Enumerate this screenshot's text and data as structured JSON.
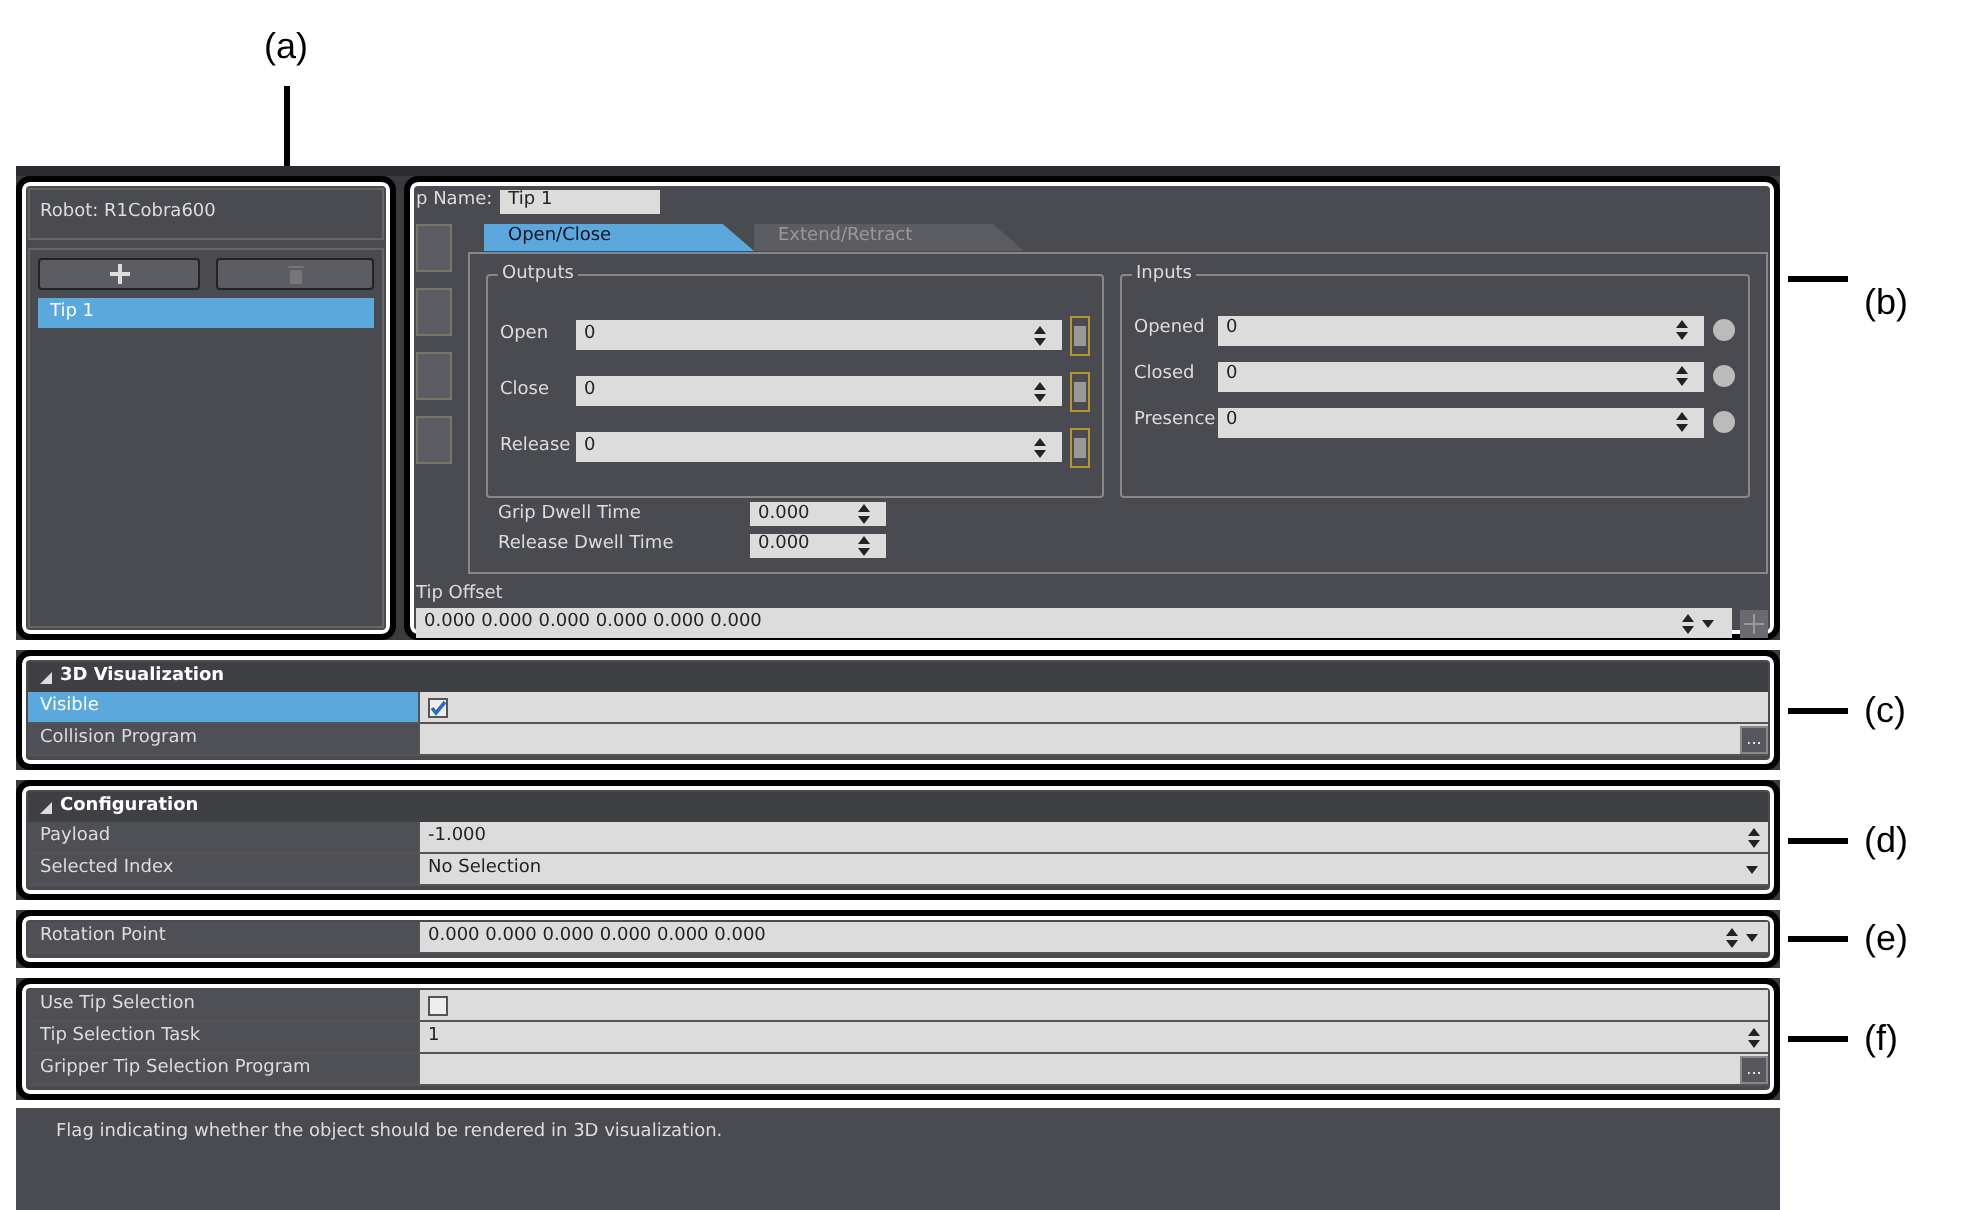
{
  "tip_list_panel": {
    "callout": "(a)",
    "robot": "Robot:  R1Cobra600",
    "items": [
      {
        "label": "Tip 1",
        "selected": true
      }
    ]
  },
  "tip_editor": {
    "callout": "(b)",
    "name_label": "p Name:",
    "name_value": "Tip 1",
    "tabs": [
      {
        "label": "Open/Close",
        "selected": true
      },
      {
        "label": "Extend/Retract",
        "selected": false
      }
    ],
    "outputs": {
      "title": "Outputs",
      "rows": [
        {
          "label": "Open",
          "value": "0"
        },
        {
          "label": "Close",
          "value": "0"
        },
        {
          "label": "Release",
          "value": "0"
        }
      ]
    },
    "inputs": {
      "title": "Inputs",
      "rows": [
        {
          "label": "Opened",
          "value": "0"
        },
        {
          "label": "Closed",
          "value": "0"
        },
        {
          "label": "Presence",
          "value": "0"
        }
      ]
    },
    "dwell": [
      {
        "label": "Grip Dwell Time",
        "value": "0.000"
      },
      {
        "label": "Release Dwell Time",
        "value": "0.000"
      }
    ],
    "tip_offset": {
      "title": "Tip Offset",
      "value": "0.000 0.000 0.000 0.000 0.000 0.000"
    }
  },
  "property_groups": [
    {
      "callout": "(c)",
      "title": "3D Visualization",
      "rows": [
        {
          "kind": "check",
          "label": "Visible",
          "checked": true,
          "selected": true
        },
        {
          "kind": "browse",
          "label": "Collision Program",
          "button": "...",
          "selected": false
        }
      ]
    },
    {
      "callout": "(d)",
      "title": "Configuration",
      "rows": [
        {
          "kind": "spin",
          "label": "Payload",
          "value": "-1.000",
          "selected": false
        },
        {
          "kind": "dropdown",
          "label": "Selected Index",
          "value": "No Selection",
          "selected": false
        }
      ]
    },
    {
      "callout": "(e)",
      "rows": [
        {
          "kind": "spindrop",
          "label": "Rotation Point",
          "value": "0.000 0.000 0.000 0.000 0.000 0.000",
          "selected": false
        }
      ]
    },
    {
      "callout": "(f)",
      "rows": [
        {
          "kind": "check",
          "label": "Use Tip Selection",
          "checked": false,
          "selected": false
        },
        {
          "kind": "spin",
          "label": "Tip Selection Task",
          "value": "1",
          "selected": false
        },
        {
          "kind": "browse",
          "label": "Gripper Tip Selection Program",
          "button": "...",
          "selected": false
        }
      ]
    }
  ],
  "description": "Flag indicating whether the object should be rendered in 3D visualization."
}
